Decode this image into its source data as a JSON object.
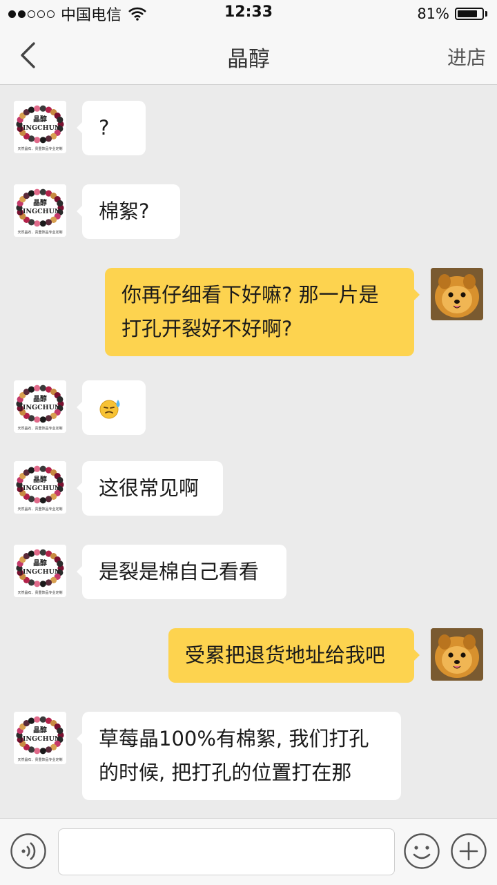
{
  "status_bar": {
    "carrier": "中国电信",
    "time": "12:33",
    "battery": "81%",
    "battery_level": 0.81,
    "signal_bars_filled": 2,
    "signal_bars_total": 5
  },
  "nav": {
    "title": "晶醇",
    "action": "进店",
    "back_icon": "chevron-left-icon"
  },
  "store_avatar": {
    "name": "晶醇",
    "brand": "JINGCHUN",
    "tagline": "天然晶石、贵重饰品专业定制"
  },
  "messages": [
    {
      "side": "in",
      "lines": [
        "?"
      ]
    },
    {
      "side": "in",
      "lines": [
        "棉絮?"
      ]
    },
    {
      "side": "out",
      "lines": [
        "你再仔细看下好嘛? 那一片是",
        "打孔开裂好不好啊?"
      ]
    },
    {
      "side": "in",
      "emoji": "sweat-smile-emoji"
    },
    {
      "side": "in",
      "lines": [
        "这很常见啊"
      ]
    },
    {
      "side": "in",
      "lines": [
        "是裂是棉自己看看"
      ]
    },
    {
      "side": "out",
      "lines": [
        "受累把退货地址给我吧"
      ]
    },
    {
      "side": "in",
      "lines": [
        "草莓晶100%有棉絮, 我们打孔",
        "的时候, 把打孔的位置打在那"
      ]
    }
  ],
  "input_bar": {
    "voice_icon": "voice-icon",
    "placeholder": "",
    "emoji_icon": "smiley-icon",
    "plus_icon": "plus-icon"
  },
  "colors": {
    "background": "#ebebeb",
    "bar": "#f7f7f7",
    "incoming_bubble": "#ffffff",
    "outgoing_bubble": "#fdd34f"
  }
}
